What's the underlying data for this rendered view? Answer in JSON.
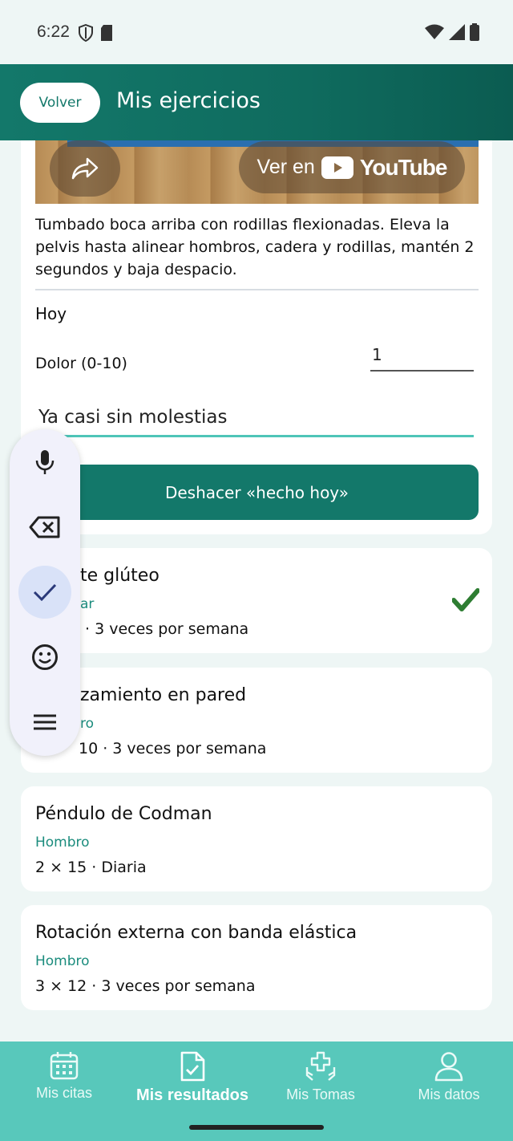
{
  "status_bar": {
    "time": "6:22"
  },
  "header": {
    "back_label": "Volver",
    "title": "Mis ejercicios"
  },
  "detail": {
    "youtube_prefix": "Ver en",
    "youtube_brand": "YouTube",
    "description": "Tumbado boca arriba con rodillas flexionadas. Eleva la pelvis hasta alinear hombros, cadera y rodillas, mantén 2 segundos y baja despacio.",
    "today_label": "Hoy",
    "pain_label": "Dolor (0-10)",
    "pain_value": "1",
    "note_value": "Ya casi sin molestias",
    "undo_label": "Deshacer «hecho hoy»"
  },
  "exercises": [
    {
      "title": "te glúteo",
      "area": "ar",
      "dose": "· 3 veces por semana",
      "done": true
    },
    {
      "title": "zamiento en pared",
      "area": "ro",
      "dose": "10 · 3 veces por semana",
      "done": false
    },
    {
      "title": "Péndulo de Codman",
      "area": "Hombro",
      "dose": "2 × 15 · Diaria",
      "done": false
    },
    {
      "title": "Rotación externa con banda elástica",
      "area": "Hombro",
      "dose": "3 × 12 · 3 veces por semana",
      "done": false
    }
  ],
  "keyboard_toolbar": {
    "tools": [
      "microphone-icon",
      "backspace-icon",
      "check-icon",
      "emoji-icon",
      "menu-icon"
    ],
    "active_tool": "check-icon"
  },
  "bottom_nav": {
    "items": [
      {
        "label": "Mis citas",
        "icon": "calendar-icon"
      },
      {
        "label": "Mis resultados",
        "icon": "document-check-icon",
        "active": true
      },
      {
        "label": "Mis Tomas",
        "icon": "hands-medical-icon"
      },
      {
        "label": "Mis datos",
        "icon": "person-icon"
      }
    ]
  },
  "colors": {
    "primary": "#13786a",
    "accent": "#4ec5b8",
    "nav": "#58c8bb",
    "area_text": "#1b8c7d",
    "check": "#2e7d32"
  }
}
